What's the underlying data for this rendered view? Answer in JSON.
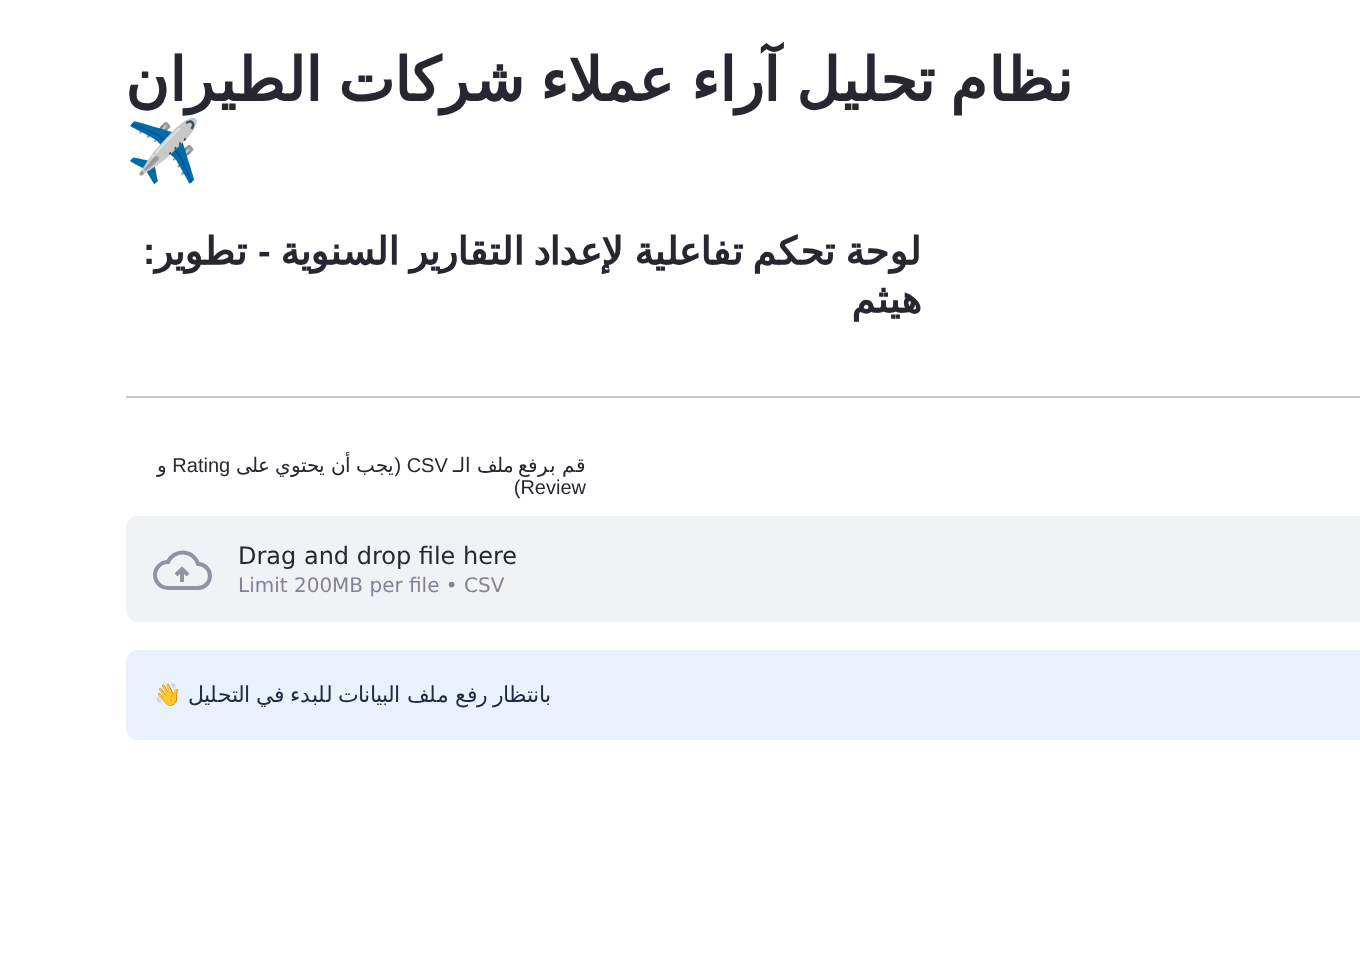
{
  "header": {
    "title": "نظام تحليل آراء عملاء شركات الطيران ✈️",
    "subtitle": "لوحة تحكم تفاعلية لإعداد التقارير السنوية - تطوير: هيثم"
  },
  "uploader": {
    "label": "قم برفع ملف الـ CSV (يجب أن يحتوي على Rating و Review)",
    "prompt": "Drag and drop file here",
    "limit": "Limit 200MB per file • CSV"
  },
  "info": {
    "message": "بانتظار رفع ملف البيانات للبدء في التحليل 👋"
  }
}
